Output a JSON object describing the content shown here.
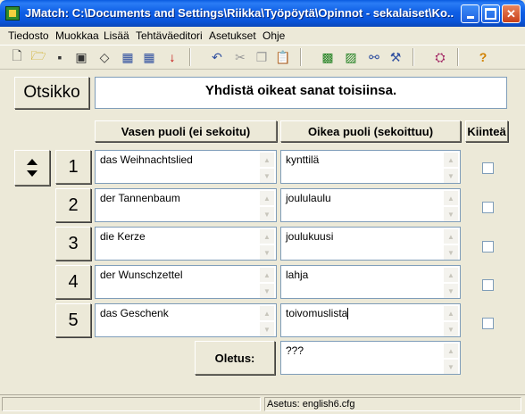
{
  "window": {
    "title": "JMatch: C:\\Documents and Settings\\Riikka\\Työpöytä\\Opinnot - sekalaiset\\Ko...",
    "controls": [
      "minimize",
      "maximize",
      "close"
    ]
  },
  "menu": [
    "Tiedosto",
    "Muokkaa",
    "Lisää",
    "Tehtäväeditori",
    "Asetukset",
    "Ohje"
  ],
  "toolbar": {
    "icons": [
      "new-file-icon",
      "open-folder-icon",
      "save-icon",
      "save-as-icon",
      "eraser-icon",
      "web-export-icon",
      "web-export2-icon",
      "down-arrow-icon",
      "undo-icon",
      "cut-icon",
      "copy-icon",
      "paste-icon",
      "image-icon",
      "picture-icon",
      "link-icon",
      "tool-icon",
      "config-icon",
      "help-icon"
    ]
  },
  "header": {
    "title_button": "Otsikko",
    "title_value": "Yhdistä oikeat sanat toisiinsa."
  },
  "columns": {
    "left": "Vasen puoli (ei sekoitu)",
    "right": "Oikea puoli (sekoittuu)",
    "fixed": "Kiinteä"
  },
  "rows": [
    {
      "num": "1",
      "left": "das Weihnachtslied",
      "right": "kynttilä",
      "fixed": false
    },
    {
      "num": "2",
      "left": "der Tannenbaum",
      "right": "joululaulu",
      "fixed": false
    },
    {
      "num": "3",
      "left": "die Kerze",
      "right": "joulukuusi",
      "fixed": false
    },
    {
      "num": "4",
      "left": "der Wunschzettel",
      "right": "lahja",
      "fixed": false
    },
    {
      "num": "5",
      "left": "das Geschenk",
      "right": "toivomuslista",
      "fixed": false
    }
  ],
  "default": {
    "label": "Oletus:",
    "value": "???"
  },
  "status": {
    "config": "Asetus: english6.cfg"
  }
}
